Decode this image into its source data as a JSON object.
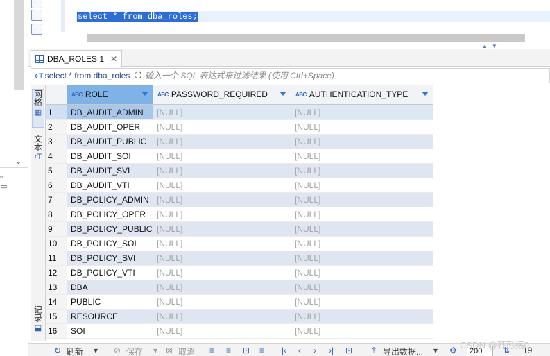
{
  "editor": {
    "sql_line": "select * from dba_roles;"
  },
  "result_tab": {
    "label": "DBA_ROLES 1",
    "close": "✕"
  },
  "filter": {
    "query_label": "select * from dba_roles",
    "placeholder": "输入一个 SQL 表达式来过滤结果 (使用 Ctrl+Space)"
  },
  "side_tabs": {
    "grid": "网格",
    "text": "文本",
    "record": "记录"
  },
  "grid": {
    "columns": [
      {
        "label": "ROLE",
        "type_badge": "ABC"
      },
      {
        "label": "PASSWORD_REQUIRED",
        "type_badge": "ABC"
      },
      {
        "label": "AUTHENTICATION_TYPE",
        "type_badge": "ABC"
      }
    ],
    "rows": [
      {
        "n": "1",
        "role": "DB_AUDIT_ADMIN",
        "password_required": "[NULL]",
        "authentication_type": "[NULL]"
      },
      {
        "n": "2",
        "role": "DB_AUDIT_OPER",
        "password_required": "[NULL]",
        "authentication_type": "[NULL]"
      },
      {
        "n": "3",
        "role": "DB_AUDIT_PUBLIC",
        "password_required": "[NULL]",
        "authentication_type": "[NULL]"
      },
      {
        "n": "4",
        "role": "DB_AUDIT_SOI",
        "password_required": "[NULL]",
        "authentication_type": "[NULL]"
      },
      {
        "n": "5",
        "role": "DB_AUDIT_SVI",
        "password_required": "[NULL]",
        "authentication_type": "[NULL]"
      },
      {
        "n": "6",
        "role": "DB_AUDIT_VTI",
        "password_required": "[NULL]",
        "authentication_type": "[NULL]"
      },
      {
        "n": "7",
        "role": "DB_POLICY_ADMIN",
        "password_required": "[NULL]",
        "authentication_type": "[NULL]"
      },
      {
        "n": "8",
        "role": "DB_POLICY_OPER",
        "password_required": "[NULL]",
        "authentication_type": "[NULL]"
      },
      {
        "n": "9",
        "role": "DB_POLICY_PUBLIC",
        "password_required": "[NULL]",
        "authentication_type": "[NULL]"
      },
      {
        "n": "10",
        "role": "DB_POLICY_SOI",
        "password_required": "[NULL]",
        "authentication_type": "[NULL]"
      },
      {
        "n": "11",
        "role": "DB_POLICY_SVI",
        "password_required": "[NULL]",
        "authentication_type": "[NULL]"
      },
      {
        "n": "12",
        "role": "DB_POLICY_VTI",
        "password_required": "[NULL]",
        "authentication_type": "[NULL]"
      },
      {
        "n": "13",
        "role": "DBA",
        "password_required": "[NULL]",
        "authentication_type": "[NULL]"
      },
      {
        "n": "14",
        "role": "PUBLIC",
        "password_required": "[NULL]",
        "authentication_type": "[NULL]"
      },
      {
        "n": "15",
        "role": "RESOURCE",
        "password_required": "[NULL]",
        "authentication_type": "[NULL]"
      },
      {
        "n": "16",
        "role": "SOI",
        "password_required": "[NULL]",
        "authentication_type": "[NULL]"
      }
    ]
  },
  "bottom_toolbar": {
    "refresh": "刷新",
    "save": "保存",
    "cancel": "取消",
    "export": "导出数据...",
    "fetch_size": "200",
    "row_count": "19"
  },
  "watermark": "CSDN @齐彭殇0",
  "colors": {
    "accent": "#2e63b5",
    "selection": "#2f6dd6",
    "header_selected": "#7fb3e8",
    "alt_row": "#dfe6f1",
    "null_text": "#a3a3a3"
  }
}
